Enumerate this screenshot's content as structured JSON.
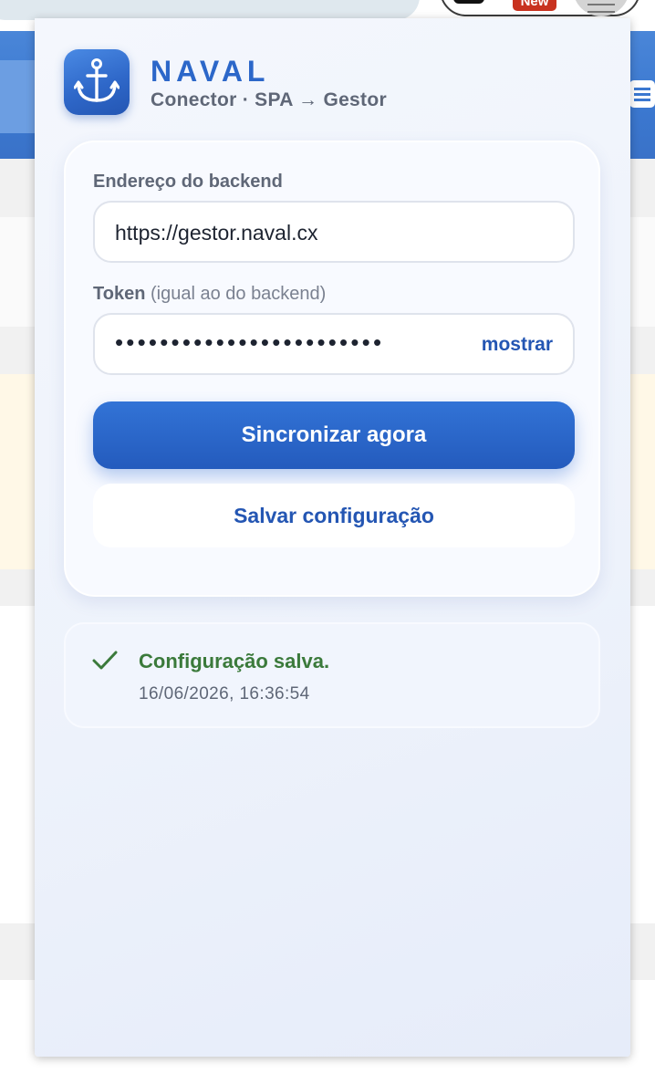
{
  "browser": {
    "new_badge": "New"
  },
  "app": {
    "title": "NAVAL",
    "subtitle": "Conector · SPA → Gestor",
    "logo_icon": "anchor-icon",
    "accent_color": "#2c67c9"
  },
  "form": {
    "backend_label": "Endereço do backend",
    "backend_value": "https://gestor.naval.cx",
    "token_label": "Token",
    "token_hint": "(igual ao do backend)",
    "token_masked": "••••••••••••••••••••••••",
    "show_label": "mostrar",
    "sync_button": "Sincronizar agora",
    "save_button": "Salvar configuração"
  },
  "status": {
    "icon": "check-icon",
    "message": "Configuração salva.",
    "timestamp": "16/06/2026, 16:36:54",
    "color": "#3b7a3b"
  }
}
